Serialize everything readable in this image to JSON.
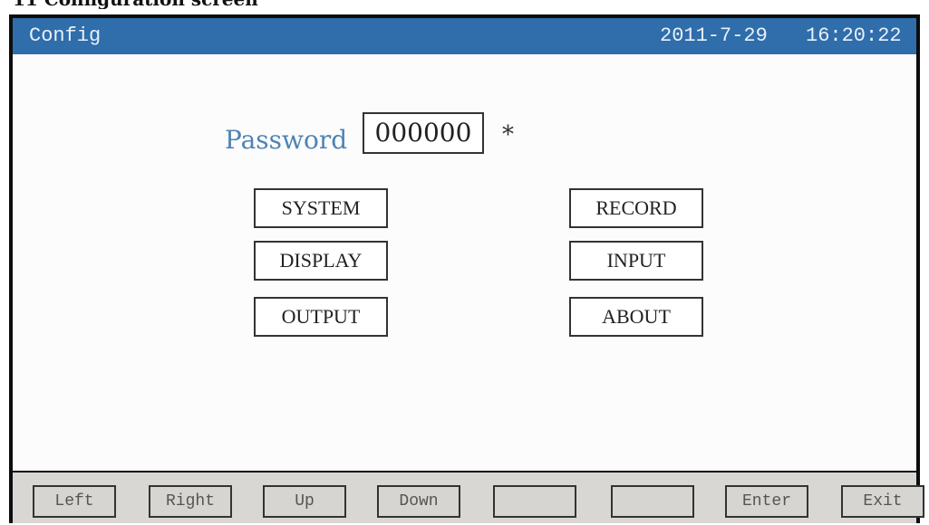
{
  "caption": "11 Configuration screen",
  "titlebar": {
    "title": "Config",
    "date": "2011-7-29",
    "time": "16:20:22",
    "bg_color": "#2f6dab"
  },
  "password": {
    "label": "Password",
    "value": "000000",
    "indicator": "*"
  },
  "menu": {
    "system": "SYSTEM",
    "record": "RECORD",
    "display": "DISPLAY",
    "input": "INPUT",
    "output": "OUTPUT",
    "about": "ABOUT"
  },
  "function_keys": {
    "left": "Left",
    "right": "Right",
    "up": "Up",
    "down": "Down",
    "f5": "",
    "f6": "",
    "enter": "Enter",
    "exit": "Exit"
  }
}
